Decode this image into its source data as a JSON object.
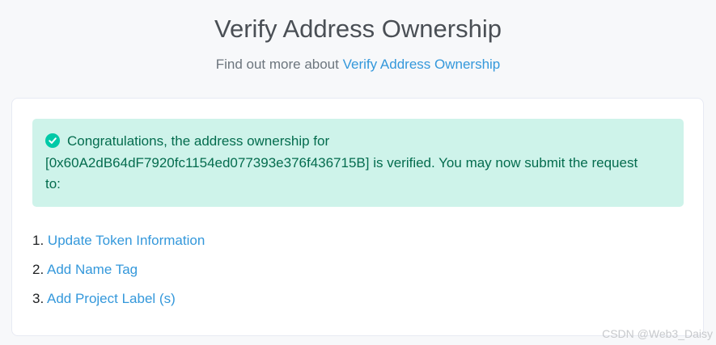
{
  "header": {
    "title": "Verify Address Ownership",
    "subtitle_prefix": "Find out more about",
    "subtitle_link": "Verify Address Ownership"
  },
  "alert": {
    "icon": "check-circle-icon",
    "line1": "Congratulations, the address ownership for",
    "line2": "[0x60A2dB64dF7920fc1154ed077393e376f436715B] is verified. You may now submit the request",
    "line3": "to:"
  },
  "steps": [
    {
      "number": "1.",
      "label": "Update Token Information"
    },
    {
      "number": "2.",
      "label": "Add Name Tag"
    },
    {
      "number": "3.",
      "label": "Add Project Label (s)"
    }
  ],
  "watermark": "CSDN @Web3_Daisy",
  "colors": {
    "link": "#3498db",
    "alert_bg": "#cef3ea",
    "alert_text": "#046c4e",
    "success": "#00c9a7"
  }
}
